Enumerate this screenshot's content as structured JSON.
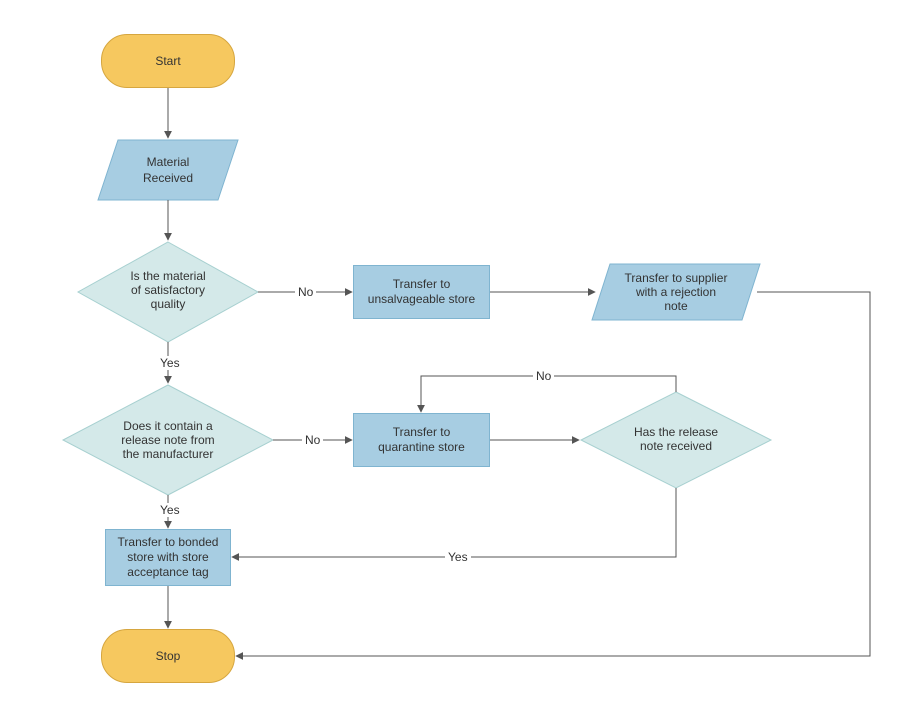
{
  "colors": {
    "terminator_fill": "#f6c85f",
    "terminator_stroke": "#d6a63f",
    "process_fill": "#a7cde2",
    "process_stroke": "#7fb4d0",
    "decision_fill": "#d4e9e9",
    "decision_stroke": "#a7d0d0",
    "connector": "#555555"
  },
  "nodes": {
    "start": {
      "type": "terminator",
      "label": "Start"
    },
    "material_received": {
      "type": "io",
      "label_l1": "Material",
      "label_l2": "Received"
    },
    "quality_check": {
      "type": "decision",
      "label_l1": "Is the material",
      "label_l2": "of satisfactory",
      "label_l3": "quality"
    },
    "unsalvageable": {
      "type": "process",
      "label_l1": "Transfer to",
      "label_l2": "unsalvageable store"
    },
    "supplier_reject": {
      "type": "io",
      "label_l1": "Transfer to supplier",
      "label_l2": "with a rejection",
      "label_l3": "note"
    },
    "release_note_check": {
      "type": "decision",
      "label_l1": "Does it contain a",
      "label_l2": "release note from",
      "label_l3": "the manufacturer"
    },
    "quarantine": {
      "type": "process",
      "label_l1": "Transfer to",
      "label_l2": "quarantine store"
    },
    "note_received": {
      "type": "decision",
      "label_l1": "Has the release",
      "label_l2": "note received"
    },
    "bonded": {
      "type": "process",
      "label_l1": "Transfer to bonded",
      "label_l2": "store with store",
      "label_l3": "acceptance tag"
    },
    "stop": {
      "type": "terminator",
      "label": "Stop"
    }
  },
  "edges": {
    "start_to_material": {
      "label": ""
    },
    "material_to_quality": {
      "label": ""
    },
    "quality_no": {
      "label": "No"
    },
    "unsalvageable_to_supplier": {
      "label": ""
    },
    "quality_yes": {
      "label": "Yes"
    },
    "release_no": {
      "label": "No"
    },
    "quarantine_to_note": {
      "label": ""
    },
    "note_no": {
      "label": "No"
    },
    "release_yes": {
      "label": "Yes"
    },
    "note_yes": {
      "label": "Yes"
    },
    "bonded_to_stop": {
      "label": ""
    },
    "supplier_to_stop": {
      "label": ""
    }
  },
  "chart_data": {
    "type": "flowchart",
    "title": "",
    "nodes": [
      {
        "id": "start",
        "type": "terminator",
        "label": "Start"
      },
      {
        "id": "material_received",
        "type": "io",
        "label": "Material Received"
      },
      {
        "id": "quality_check",
        "type": "decision",
        "label": "Is the material of satisfactory quality"
      },
      {
        "id": "unsalvageable",
        "type": "process",
        "label": "Transfer to unsalvageable store"
      },
      {
        "id": "supplier_reject",
        "type": "io",
        "label": "Transfer to supplier with a rejection note"
      },
      {
        "id": "release_note_check",
        "type": "decision",
        "label": "Does it contain a release note from the manufacturer"
      },
      {
        "id": "quarantine",
        "type": "process",
        "label": "Transfer to quarantine store"
      },
      {
        "id": "note_received",
        "type": "decision",
        "label": "Has the release note received"
      },
      {
        "id": "bonded",
        "type": "process",
        "label": "Transfer to bonded store with store acceptance tag"
      },
      {
        "id": "stop",
        "type": "terminator",
        "label": "Stop"
      }
    ],
    "edges": [
      {
        "from": "start",
        "to": "material_received",
        "label": ""
      },
      {
        "from": "material_received",
        "to": "quality_check",
        "label": ""
      },
      {
        "from": "quality_check",
        "to": "unsalvageable",
        "label": "No"
      },
      {
        "from": "unsalvageable",
        "to": "supplier_reject",
        "label": ""
      },
      {
        "from": "quality_check",
        "to": "release_note_check",
        "label": "Yes"
      },
      {
        "from": "release_note_check",
        "to": "quarantine",
        "label": "No"
      },
      {
        "from": "quarantine",
        "to": "note_received",
        "label": ""
      },
      {
        "from": "note_received",
        "to": "quarantine",
        "label": "No"
      },
      {
        "from": "release_note_check",
        "to": "bonded",
        "label": "Yes"
      },
      {
        "from": "note_received",
        "to": "bonded",
        "label": "Yes"
      },
      {
        "from": "bonded",
        "to": "stop",
        "label": ""
      },
      {
        "from": "supplier_reject",
        "to": "stop",
        "label": ""
      }
    ]
  }
}
